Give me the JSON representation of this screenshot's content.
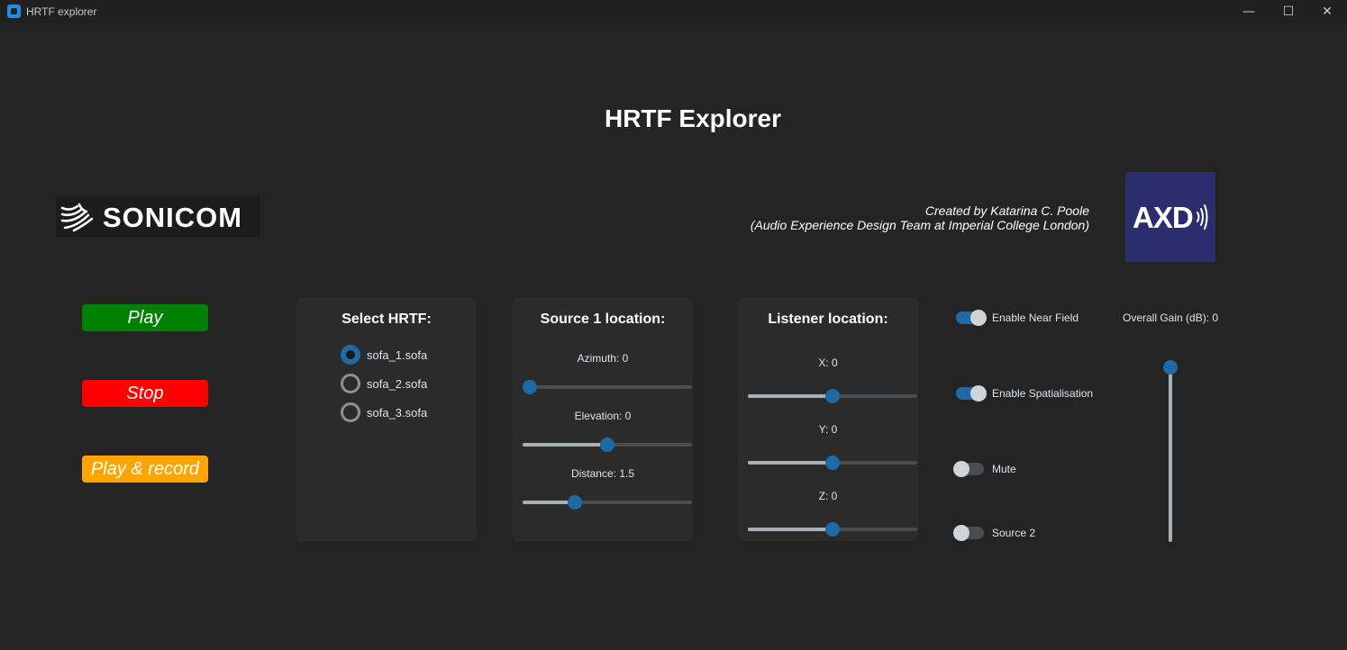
{
  "window": {
    "title": "HRTF explorer",
    "minimize": "—",
    "maximize": "☐",
    "close": "✕"
  },
  "app_title": "HRTF Explorer",
  "sonicom_logo": {
    "text": "SONICOM"
  },
  "credit": {
    "line1": "Created by Katarina C. Poole",
    "line2": "(Audio Experience Design Team at Imperial College London)"
  },
  "axd_logo": {
    "text": "AXD"
  },
  "buttons": {
    "play": {
      "label": "Play",
      "color": "#008000"
    },
    "stop": {
      "label": "Stop",
      "color": "#ff0000"
    },
    "play_record": {
      "label": "Play & record",
      "color": "#ffa500"
    }
  },
  "hrtf_panel": {
    "title": "Select HRTF:",
    "options": [
      {
        "label": "sofa_1.sofa",
        "selected": true
      },
      {
        "label": "sofa_2.sofa",
        "selected": false
      },
      {
        "label": "sofa_3.sofa",
        "selected": false
      }
    ]
  },
  "source_panel": {
    "title": "Source 1 location:",
    "sliders": [
      {
        "label": "Azimuth: 0",
        "fraction": 0.0
      },
      {
        "label": "Elevation: 0",
        "fraction": 0.5
      },
      {
        "label": "Distance: 1.5",
        "fraction": 0.29
      }
    ]
  },
  "listener_panel": {
    "title": "Listener location:",
    "sliders": [
      {
        "label": "X: 0",
        "fraction": 0.5
      },
      {
        "label": "Y: 0",
        "fraction": 0.5
      },
      {
        "label": "Z: 0",
        "fraction": 0.5
      }
    ]
  },
  "toggles": [
    {
      "label": "Enable Near Field",
      "on": true
    },
    {
      "label": "Enable Spatialisation",
      "on": true
    },
    {
      "label": "Mute",
      "on": false
    },
    {
      "label": "Source 2",
      "on": false
    }
  ],
  "gain": {
    "label": "Overall Gain (dB): 0",
    "fraction": 1.0
  },
  "colors": {
    "accent": "#1f6aa5",
    "background": "#242424",
    "panel": "#2b2b2b"
  }
}
